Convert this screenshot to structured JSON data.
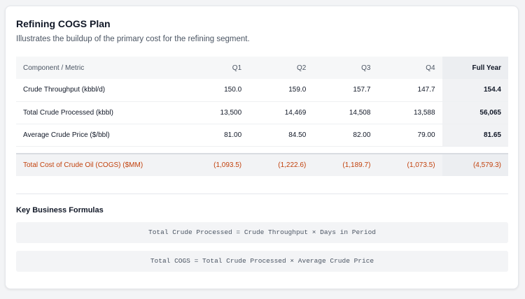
{
  "card": {
    "title": "Refining COGS Plan",
    "subtitle": "Illustrates the buildup of the primary cost for the refining segment."
  },
  "table": {
    "headers": [
      "Component / Metric",
      "Q1",
      "Q2",
      "Q3",
      "Q4",
      "Full Year"
    ],
    "rows": [
      {
        "metric": "Crude Throughput (kbbl/d)",
        "q1": "150.0",
        "q2": "159.0",
        "q3": "157.7",
        "q4": "147.7",
        "fy": "154.4"
      },
      {
        "metric": "Total Crude Processed (kbbl)",
        "q1": "13,500",
        "q2": "14,469",
        "q3": "14,508",
        "q4": "13,588",
        "fy": "56,065"
      },
      {
        "metric": "Average Crude Price ($/bbl)",
        "q1": "81.00",
        "q2": "84.50",
        "q3": "82.00",
        "q4": "79.00",
        "fy": "81.65"
      }
    ],
    "total": {
      "metric": "Total Cost of Crude Oil (COGS) ($MM)",
      "q1": "(1,093.5)",
      "q2": "(1,222.6)",
      "q3": "(1,189.7)",
      "q4": "(1,073.5)",
      "fy": "(4,579.3)"
    }
  },
  "formulas": {
    "title": "Key Business Formulas",
    "items": [
      "Total Crude Processed = Crude Throughput × Days in Period",
      "Total COGS = Total Crude Processed × Average Crude Price"
    ]
  },
  "colors": {
    "accent_total": "#c2410c",
    "header_bg": "#f6f7f8",
    "full_year_bg": "#eceef1"
  }
}
